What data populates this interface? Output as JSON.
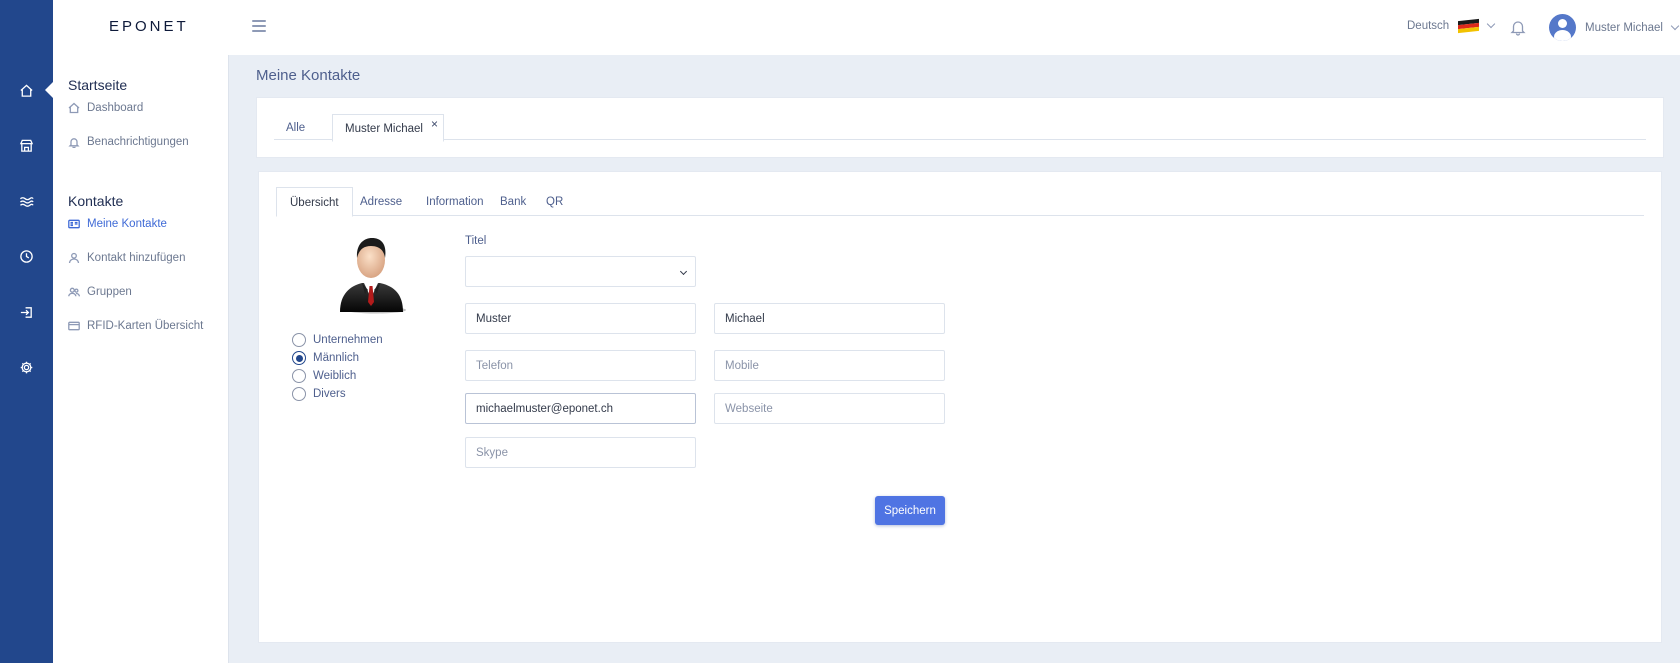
{
  "brand": {
    "logo_text": "EPONET"
  },
  "rail": {
    "icons": [
      "home-icon",
      "store-icon",
      "waves-icon",
      "clock-icon",
      "login-icon",
      "gear-icon"
    ],
    "color": "#22478c"
  },
  "header": {
    "language": "Deutsch",
    "language_flag": "german-flag-icon",
    "notifications_icon": "bell-icon",
    "user_name": "Muster Michael"
  },
  "sidebar": {
    "sections": [
      {
        "title": "Startseite",
        "items": [
          {
            "label": "Dashboard",
            "icon": "home-icon",
            "active": false
          },
          {
            "label": "Benachrichtigungen",
            "icon": "bell-icon",
            "active": false
          }
        ]
      },
      {
        "title": "Kontakte",
        "items": [
          {
            "label": "Meine Kontakte",
            "icon": "contact-card-icon",
            "active": true
          },
          {
            "label": "Kontakt hinzufügen",
            "icon": "user-icon",
            "active": false
          },
          {
            "label": "Gruppen",
            "icon": "group-icon",
            "active": false
          },
          {
            "label": "RFID-Karten Übersicht",
            "icon": "card-icon",
            "active": false
          }
        ]
      }
    ]
  },
  "page": {
    "title": "Meine Kontakte"
  },
  "top_tabs": [
    {
      "label": "Alle",
      "active": false
    },
    {
      "label": "Muster Michael",
      "active": true,
      "closable": true,
      "close_glyph": "×"
    }
  ],
  "sub_tabs": [
    {
      "label": "Übersicht",
      "active": true
    },
    {
      "label": "Adresse",
      "active": false
    },
    {
      "label": "Information",
      "active": false
    },
    {
      "label": "Bank",
      "active": false
    },
    {
      "label": "QR",
      "active": false
    }
  ],
  "form": {
    "photo": "businessman-avatar-icon",
    "gender_options": [
      {
        "label": "Unternehmen",
        "checked": false
      },
      {
        "label": "Männlich",
        "checked": true
      },
      {
        "label": "Weiblich",
        "checked": false
      },
      {
        "label": "Divers",
        "checked": false
      }
    ],
    "title_label": "Titel",
    "title_value": "",
    "lastname": {
      "value": "Muster",
      "placeholder": ""
    },
    "firstname": {
      "value": "Michael",
      "placeholder": ""
    },
    "telefon": {
      "value": "",
      "placeholder": "Telefon"
    },
    "mobile": {
      "value": "",
      "placeholder": "Mobile"
    },
    "email": {
      "value": "michaelmuster@eponet.ch",
      "placeholder": ""
    },
    "webseite": {
      "value": "",
      "placeholder": "Webseite"
    },
    "skype": {
      "value": "",
      "placeholder": "Skype"
    },
    "save_label": "Speichern"
  },
  "colors": {
    "accent": "#4f74e3",
    "active_link": "#3f6ad6",
    "background": "#e9eef5"
  }
}
